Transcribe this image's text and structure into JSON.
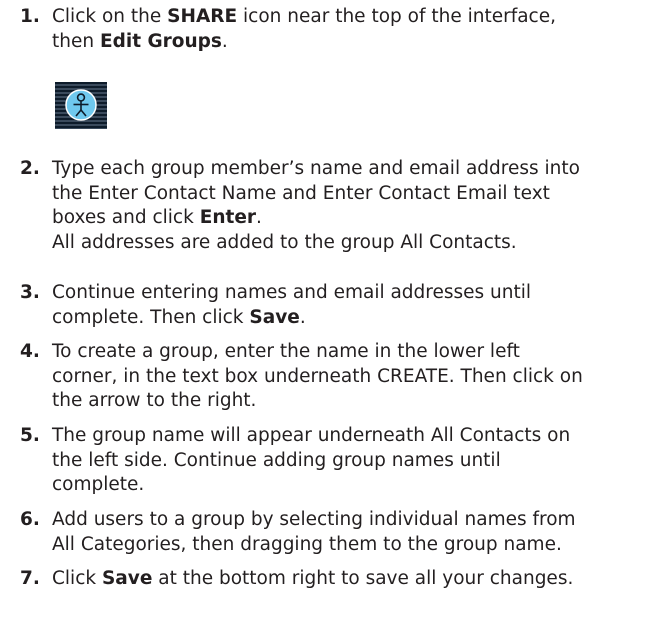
{
  "steps": [
    {
      "number": "1.",
      "lines": [
        [
          "Click on the ",
          {
            "b": "SHARE"
          },
          " icon near the top of the interface,"
        ],
        [
          "then ",
          {
            "b": "Edit Groups"
          },
          "."
        ]
      ]
    },
    {
      "number": "2.",
      "lines": [
        [
          "Type each group member’s name and email address into"
        ],
        [
          "the Enter Contact Name and Enter Contact Email text"
        ],
        [
          "boxes and click ",
          {
            "b": "Enter"
          },
          "."
        ],
        [
          "All addresses are added to the group All Contacts."
        ]
      ]
    },
    {
      "number": "3.",
      "lines": [
        [
          "Continue entering names and email addresses until"
        ],
        [
          "complete. Then click ",
          {
            "b": "Save"
          },
          "."
        ]
      ]
    },
    {
      "number": "4.",
      "lines": [
        [
          "To create a group, enter the name in the lower left"
        ],
        [
          "corner, in the text box underneath CREATE. Then click on"
        ],
        [
          "the arrow to the right."
        ]
      ]
    },
    {
      "number": "5.",
      "lines": [
        [
          "The group name will appear underneath All Contacts on"
        ],
        [
          "the left side. Continue adding group names until"
        ],
        [
          "complete."
        ]
      ]
    },
    {
      "number": "6.",
      "lines": [
        [
          "Add users to a group by selecting individual names from"
        ],
        [
          "All Categories, then dragging them to the group name."
        ]
      ]
    },
    {
      "number": "7.",
      "lines": [
        [
          "Click ",
          {
            "b": "Save"
          },
          " at the bottom right to save all your changes."
        ]
      ]
    }
  ],
  "share_icon": {
    "icon": "share-person-icon",
    "color": "#6fc8ee"
  }
}
